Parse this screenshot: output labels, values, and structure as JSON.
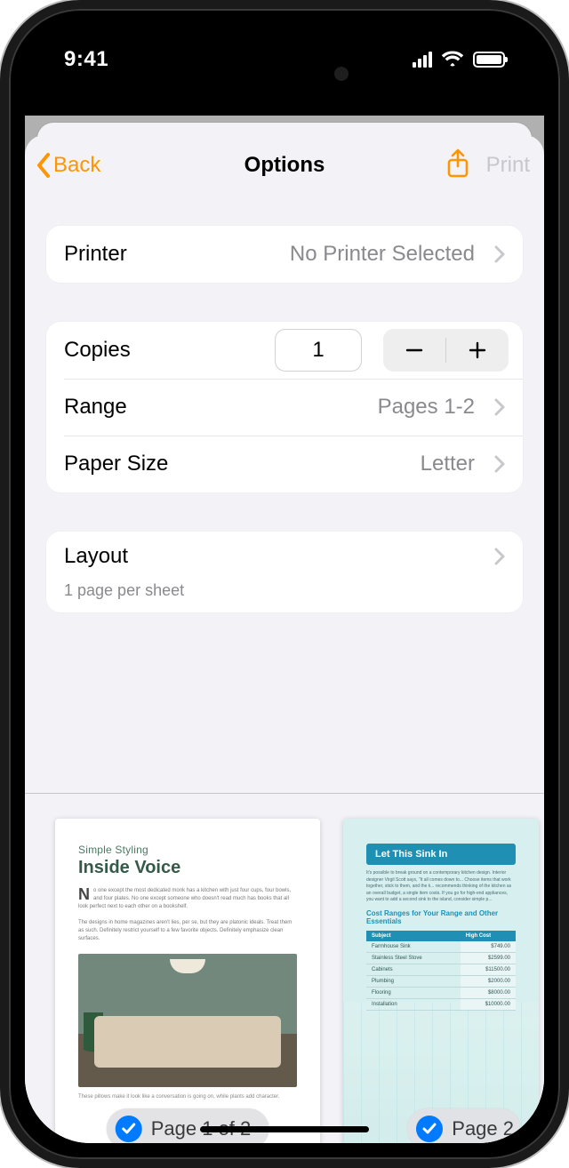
{
  "statusbar": {
    "time": "9:41"
  },
  "nav": {
    "back": "Back",
    "title": "Options",
    "print": "Print"
  },
  "printer": {
    "label": "Printer",
    "value": "No Printer Selected"
  },
  "copies": {
    "label": "Copies",
    "value": "1"
  },
  "range": {
    "label": "Range",
    "value": "Pages 1-2"
  },
  "paper_size": {
    "label": "Paper Size",
    "value": "Letter"
  },
  "layout": {
    "label": "Layout",
    "sub": "1 page per sheet"
  },
  "preview": {
    "page1": {
      "eyebrow": "Simple Styling",
      "title": "Inside Voice",
      "badge": "Page 1 of 2"
    },
    "page2": {
      "headline": "Let This Sink In",
      "subhead": "Cost Ranges for Your Range and Other Essentials",
      "table": {
        "headers": [
          "Subject",
          "High Cost"
        ],
        "rows": [
          [
            "Farmhouse Sink",
            "$749.00"
          ],
          [
            "Stainless Steel Stove",
            "$2599.00"
          ],
          [
            "Cabinets",
            "$11500.00"
          ],
          [
            "Plumbing",
            "$2000.00"
          ],
          [
            "Flooring",
            "$8000.00"
          ],
          [
            "Installation",
            "$10000.00"
          ]
        ]
      },
      "badge": "Page 2"
    }
  },
  "colors": {
    "accent": "#ff9500",
    "blue": "#007aff",
    "secondary_text": "#8a8a8e"
  }
}
